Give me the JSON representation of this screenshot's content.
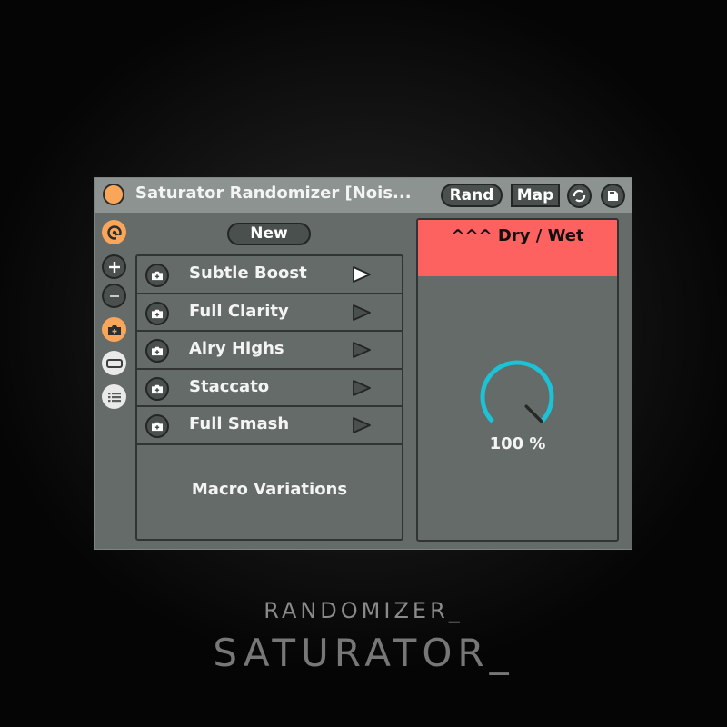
{
  "device": {
    "title": "Saturator Randomizer [Nois...",
    "buttons": {
      "rand": "Rand",
      "map": "Map"
    },
    "icons": {
      "power": "power-icon",
      "sync": "sync-icon",
      "save": "save-icon"
    },
    "side_icons": [
      "orbit-icon",
      "plus-icon",
      "minus-icon",
      "camera-add-icon",
      "collapse-icon",
      "list-icon"
    ],
    "new_label": "New",
    "variations": [
      {
        "label": "Subtle Boost",
        "active": true
      },
      {
        "label": "Full Clarity",
        "active": false
      },
      {
        "label": "Airy Highs",
        "active": false
      },
      {
        "label": "Staccato",
        "active": false
      },
      {
        "label": "Full Smash",
        "active": false
      }
    ],
    "list_footer": "Macro Variations",
    "macro": {
      "title": "^^^ Dry / Wet",
      "value_text": "100 %",
      "value_percent": 100
    },
    "colors": {
      "accent_orange": "#f9a55a",
      "header_red": "#fd6160",
      "knob_cyan": "#1cc3d6"
    }
  },
  "caption": {
    "line1": "RANDOMIZER_",
    "line2": "SATURATOR_"
  }
}
